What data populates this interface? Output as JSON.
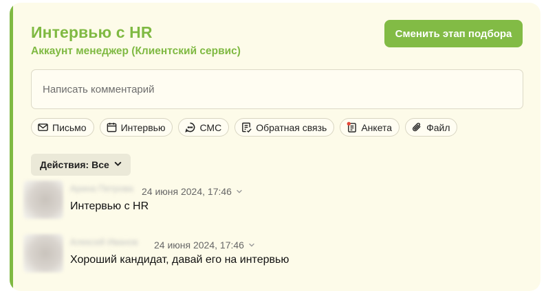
{
  "stage": {
    "title": "Интервью с HR",
    "subtitle": "Аккаунт менеджер (Клиентский сервис)",
    "change_stage_button": "Сменить этап подбора"
  },
  "comment": {
    "placeholder": "Написать комментарий"
  },
  "actions": [
    {
      "label": "Письмо",
      "icon": "mail-icon"
    },
    {
      "label": "Интервью",
      "icon": "calendar-icon"
    },
    {
      "label": "СМС",
      "icon": "sms-chat-icon"
    },
    {
      "label": "Обратная связь",
      "icon": "feedback-form-icon"
    },
    {
      "label": "Анкета",
      "icon": "questionnaire-icon"
    },
    {
      "label": "Файл",
      "icon": "paperclip-icon"
    }
  ],
  "filter": {
    "label": "Действия: Все"
  },
  "entries": [
    {
      "author": "Арина Петрова",
      "timestamp": "24 июня 2024, 17:46",
      "text": "Интервью с HR"
    },
    {
      "author": "Алексей Иванов",
      "timestamp": "24 июня 2024, 17:46",
      "text": "Хороший кандидат, давай его на интервью"
    }
  ],
  "colors": {
    "accent": "#7fb942",
    "card_background": "#fdfbe9",
    "questionnaire_badge": "#e5483a"
  }
}
